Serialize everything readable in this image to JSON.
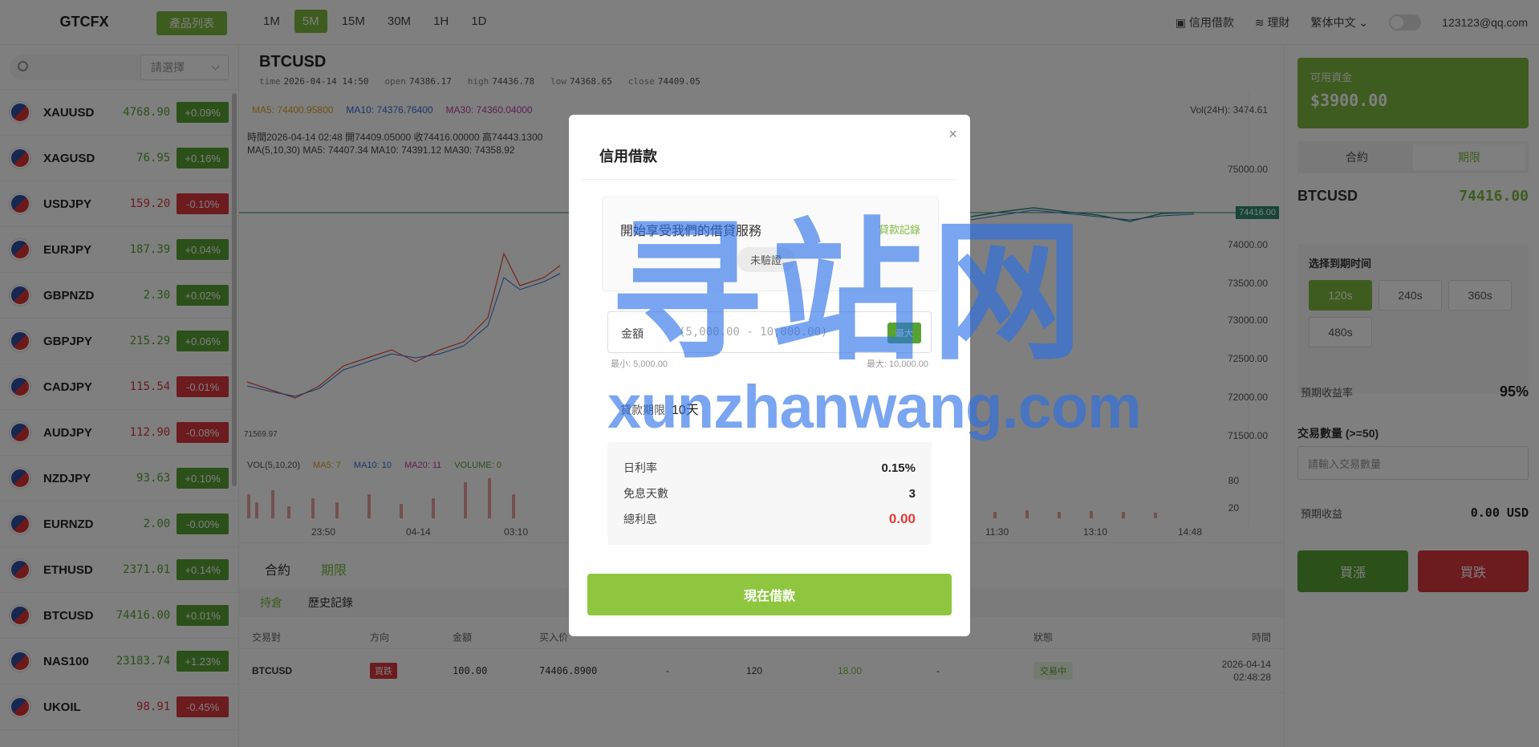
{
  "app": {
    "brand": "GTCFX",
    "products_button": "產品列表",
    "timeframes": [
      "1M",
      "5M",
      "15M",
      "30M",
      "1H",
      "1D"
    ],
    "active_timeframe": "5M",
    "credit_loan_link": "信用借款",
    "finance_link": "理財",
    "language": "繁体中文",
    "user_email": "123123@qq.com"
  },
  "sidebar": {
    "search_placeholder": "",
    "select_placeholder": "請選擇",
    "symbols": [
      {
        "name": "XAUUSD",
        "price": "4768.90",
        "change": "+0.09%",
        "dir": "up"
      },
      {
        "name": "XAGUSD",
        "price": "76.95",
        "change": "+0.16%",
        "dir": "up"
      },
      {
        "name": "USDJPY",
        "price": "159.20",
        "change": "-0.10%",
        "dir": "down"
      },
      {
        "name": "EURJPY",
        "price": "187.39",
        "change": "+0.04%",
        "dir": "up"
      },
      {
        "name": "GBPNZD",
        "price": "2.30",
        "change": "+0.02%",
        "dir": "up"
      },
      {
        "name": "GBPJPY",
        "price": "215.29",
        "change": "+0.06%",
        "dir": "up"
      },
      {
        "name": "CADJPY",
        "price": "115.54",
        "change": "-0.01%",
        "dir": "down"
      },
      {
        "name": "AUDJPY",
        "price": "112.90",
        "change": "-0.08%",
        "dir": "down"
      },
      {
        "name": "NZDJPY",
        "price": "93.63",
        "change": "+0.10%",
        "dir": "up"
      },
      {
        "name": "EURNZD",
        "price": "2.00",
        "change": "-0.00%",
        "dir": "up"
      },
      {
        "name": "ETHUSD",
        "price": "2371.01",
        "change": "+0.14%",
        "dir": "up"
      },
      {
        "name": "BTCUSD",
        "price": "74416.00",
        "change": "+0.01%",
        "dir": "up"
      },
      {
        "name": "NAS100",
        "price": "23183.74",
        "change": "+1.23%",
        "dir": "up"
      },
      {
        "name": "UKOIL",
        "price": "98.91",
        "change": "-0.45%",
        "dir": "down"
      }
    ]
  },
  "chart": {
    "symbol": "BTCUSD",
    "ohlc": {
      "time_label": "time",
      "time": "2026-04-14 14:50",
      "open_label": "open",
      "open": "74386.17",
      "high_label": "high",
      "high": "74436.78",
      "low_label": "low",
      "low": "74368.65",
      "close_label": "close",
      "close": "74409.05"
    },
    "ma5": "MA5: 74400.95800",
    "ma10": "MA10: 74376.76400",
    "ma30": "MA30: 74360.04000",
    "vol24h": "Vol(24H): 3474.61",
    "info_line1": "時間2026-04-14 02:48    開74409.05000    收74416.00000    高74443.1300",
    "info_line2": "MA(5,10,30)    MA5: 74407.34    MA10: 74391.12    MA30: 74358.92",
    "last_price": "74416.00",
    "low_mark": "71569.97",
    "vol_info": {
      "label": "VOL(5,10,20)",
      "ma5": "MA5: 7",
      "ma10": "MA10: 10",
      "ma20": "MA20: 11",
      "volume": "VOLUME: 0"
    },
    "y_axis": [
      "75000.00",
      "74000.00",
      "73500.00",
      "73000.00",
      "72500.00",
      "72000.00",
      "71500.00"
    ],
    "vol_axis": [
      "80",
      "20"
    ],
    "x_axis_left": [
      "23:50",
      "04-14",
      "03:10"
    ],
    "x_axis_right": [
      "11:30",
      "13:10",
      "14:48"
    ]
  },
  "orders": {
    "tabs": [
      "合約",
      "期限"
    ],
    "active_tab": "期限",
    "subtabs": [
      "持倉",
      "歷史記錄"
    ],
    "active_subtab": "持倉",
    "headers": {
      "pair": "交易對",
      "direction": "方向",
      "amount": "金額",
      "buy_price": "买入价",
      "status": "狀態",
      "time": "時間"
    },
    "row": {
      "pair": "BTCUSD",
      "direction": "買跌",
      "amount": "100.00",
      "buy_price": "74406.8900",
      "col5": "-",
      "col6": "120",
      "col7": "18.00",
      "col8": "-",
      "status": "交易中",
      "date": "2026-04-14",
      "time": "02:48:28"
    }
  },
  "right_panel": {
    "funds_label": "可用資金",
    "funds_amount": "$3900.00",
    "segments": [
      "合約",
      "期限"
    ],
    "active_segment": "期限",
    "symbol": "BTCUSD",
    "price": "74416.00",
    "expiry_title": "选择到期时间",
    "durations": [
      "120s",
      "240s",
      "360s",
      "480s"
    ],
    "active_duration": "120s",
    "yield_label": "預期收益率",
    "yield_value": "95%",
    "qty_label": "交易數量 (>=50)",
    "qty_placeholder": "請輸入交易數量",
    "expected_return_label": "預期收益",
    "expected_return_value": "0.00 USD",
    "buy_up": "買漲",
    "buy_down": "買跌"
  },
  "modal": {
    "title": "信用借款",
    "close_glyph": "×",
    "card_text": "開始享受我們的借貸服務",
    "loan_records": "貸款記錄",
    "verify_status": "未驗證",
    "amount_label": "金額",
    "amount_placeholder": "(5,000.00 - 10,000.00)",
    "max_button": "最大",
    "min_text": "最小: 5,000.00",
    "max_text": "最大: 10,000.00",
    "term_label": "貸款期限",
    "term_value": "10天",
    "daily_rate_label": "日利率",
    "daily_rate": "0.15%",
    "free_days_label": "免息天數",
    "free_days": "3",
    "total_interest_label": "總利息",
    "total_interest": "0.00",
    "borrow_button": "現在借款"
  },
  "watermark": {
    "big": "寻站网",
    "small": "xunzhanwang.com"
  },
  "colors": {
    "accent": "#7cb83e",
    "up": "#58a133",
    "down": "#d9363e",
    "overlay": "rgba(0,0,0,0.5)"
  }
}
